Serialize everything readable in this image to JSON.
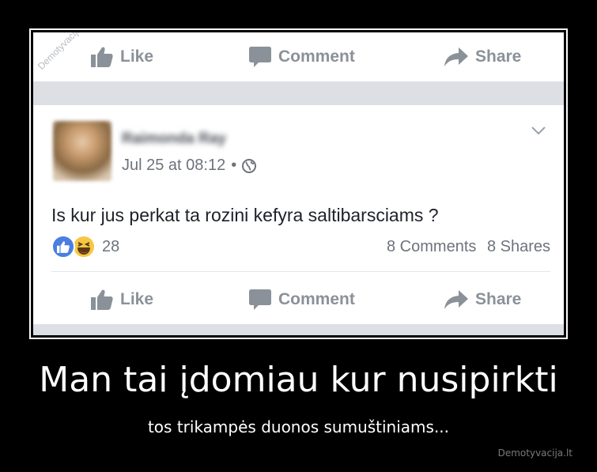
{
  "post": {
    "author": "Raimonda Ray",
    "date": "Jul 25 at 08:12",
    "dot": "•",
    "text": "Is kur jus perkat ta rozini kefyra saltibarsciams ?",
    "reaction_count": "28",
    "comments_count": "8 Comments",
    "shares_count": "8 Shares"
  },
  "actions_top": {
    "like": "Like",
    "comment": "Comment",
    "share": "Share"
  },
  "actions_bottom": {
    "like": "Like",
    "comment": "Comment",
    "share": "Share"
  },
  "watermark": "Demotyvacija.lt",
  "caption": {
    "title": "Man tai įdomiau kur nusipirkti",
    "subtitle": "tos trikampės duonos sumuštiniams...",
    "site": "Demotyvacija.lt"
  },
  "icons": {
    "like": "thumbs-up-icon",
    "comment": "comment-bubble-icon",
    "share": "share-arrow-icon",
    "privacy": "globe-icon",
    "menu": "chevron-down-icon",
    "reaction_like": "like-reaction-icon",
    "reaction_haha": "haha-reaction-icon"
  },
  "colors": {
    "action_gray": "#8b9199",
    "like_blue": "#4a7fe0",
    "haha_yellow": "#f6c745",
    "separator": "#dcdfe4"
  }
}
